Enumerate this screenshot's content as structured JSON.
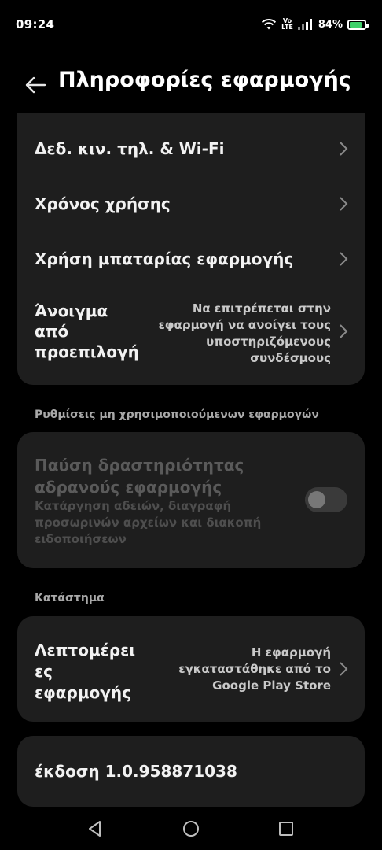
{
  "status_bar": {
    "time": "09:24",
    "volte_top": "Vo",
    "volte_bottom": "LTE",
    "battery_percent": "84%",
    "battery_level": 0.84,
    "battery_color": "#3fd16b"
  },
  "header": {
    "title": "Πληροφορίες εφαρμογής",
    "back_icon": "arrow-left-icon"
  },
  "main_card": {
    "items": [
      {
        "label": "Δεδ. κιν. τηλ. & Wi-Fi"
      },
      {
        "label": "Χρόνος χρήσης"
      },
      {
        "label": "Χρήση μπαταρίας εφαρμογής"
      },
      {
        "label_lines": [
          "Άνοιγμα",
          "από",
          "προεπιλογή"
        ],
        "value_lines": [
          "Να επιτρέπεται στην",
          "εφαρμογή να ανοίγει τους",
          "υποστηριζόμενους",
          "συνδέσμους"
        ]
      }
    ]
  },
  "unused_section": {
    "header": "Ρυθμίσεις μη χρησιμοποιούμενων εφαρμογών",
    "title_lines": [
      "Παύση δραστηριότητας",
      "αδρανούς εφαρμογής"
    ],
    "subtitle_lines": [
      "Κατάργηση αδειών, διαγραφή",
      "προσωρινών αρχείων και διακοπή",
      "ειδοποιήσεων"
    ],
    "toggle_on": false,
    "disabled": true
  },
  "store_section": {
    "header": "Κατάστημα",
    "label_lines": [
      "Λεπτομέρει",
      "ες",
      "εφαρμογής"
    ],
    "value_lines": [
      "Η εφαρμογή",
      "εγκαταστάθηκε από το",
      "Google Play Store"
    ]
  },
  "version": {
    "text": "έκδοση 1.0.958871038"
  },
  "nav_bar": {
    "back_icon": "triangle-back-icon",
    "home_icon": "circle-home-icon",
    "recents_icon": "square-recents-icon"
  }
}
